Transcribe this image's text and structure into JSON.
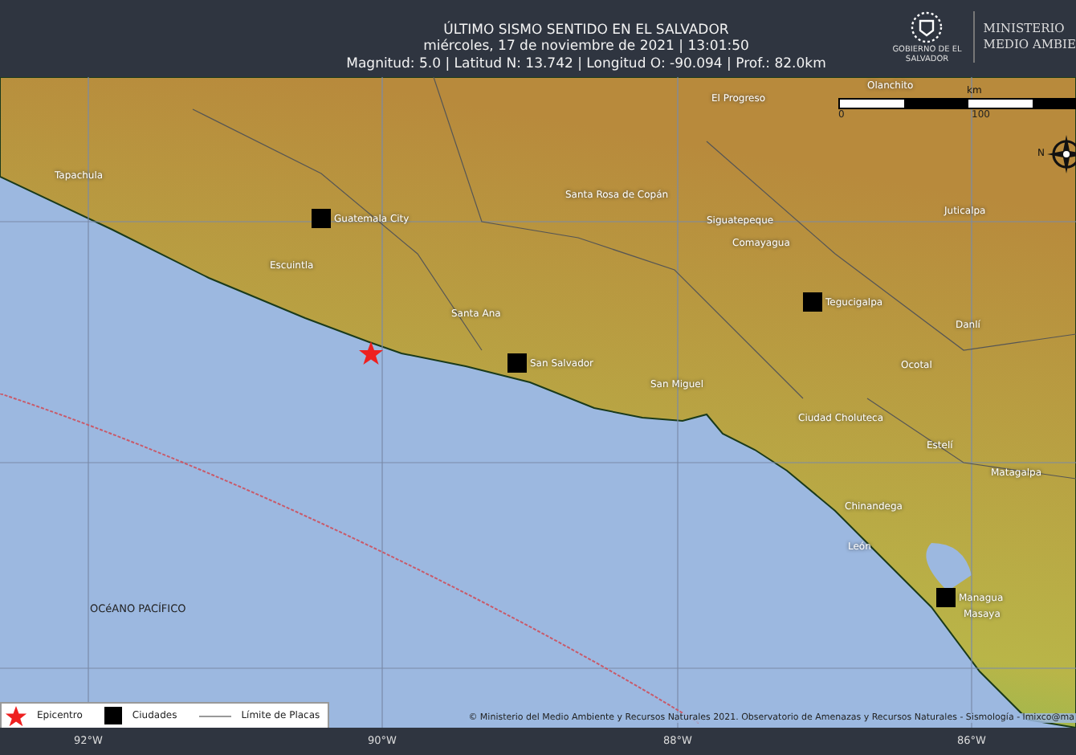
{
  "header": {
    "title": "ÚLTIMO SISMO SENTIDO EN EL SALVADOR",
    "date": "miércoles, 17 de noviembre de 2021 | 13:01:50",
    "details": "Magnitud: 5.0 | Latitud N: 13.742 | Longitud O: -90.094 | Prof.: 82.0km"
  },
  "logo": {
    "emblem_caption": "GOBIERNO DE EL SALVADOR",
    "lines": [
      "MINISTERIO",
      "MEDIO AMBIE"
    ]
  },
  "map": {
    "ocean_label": "OCéANO PACÍFICO",
    "cities": [
      {
        "name": "Tapachula",
        "capital": false
      },
      {
        "name": "Guatemala City",
        "capital": true
      },
      {
        "name": "Escuintla",
        "capital": false
      },
      {
        "name": "Santa Ana",
        "capital": false
      },
      {
        "name": "San Salvador",
        "capital": true
      },
      {
        "name": "San Miguel",
        "capital": false
      },
      {
        "name": "El Progreso",
        "capital": false
      },
      {
        "name": "Olanchito",
        "capital": false
      },
      {
        "name": "Santa Rosa de Copán",
        "capital": false
      },
      {
        "name": "Siguatepeque",
        "capital": false
      },
      {
        "name": "Comayagua",
        "capital": false
      },
      {
        "name": "Tegucigalpa",
        "capital": true
      },
      {
        "name": "Juticalpa",
        "capital": false
      },
      {
        "name": "Danlí",
        "capital": false
      },
      {
        "name": "Ocotal",
        "capital": false
      },
      {
        "name": "Ciudad Choluteca",
        "capital": false
      },
      {
        "name": "Estelí",
        "capital": false
      },
      {
        "name": "Matagalpa",
        "capital": false
      },
      {
        "name": "Chinandega",
        "capital": false
      },
      {
        "name": "León",
        "capital": false
      },
      {
        "name": "Managua",
        "capital": true
      },
      {
        "name": "Masaya",
        "capital": false
      }
    ],
    "scale": {
      "unit": "km",
      "start": "0",
      "mid": "100"
    },
    "compass": {
      "north": "N"
    },
    "credit": "© Ministerio del Medio Ambiente y Recursos Naturales 2021. Observatorio de Amenazas y Recursos Naturales - Sismología - lmixco@ma"
  },
  "legend": [
    {
      "kind": "star",
      "label": "Epicentro"
    },
    {
      "kind": "square",
      "label": "Ciudades"
    },
    {
      "kind": "line",
      "label": "Límite de Placas"
    }
  ],
  "axis": [
    "92°W",
    "90°W",
    "88°W",
    "86°W"
  ]
}
